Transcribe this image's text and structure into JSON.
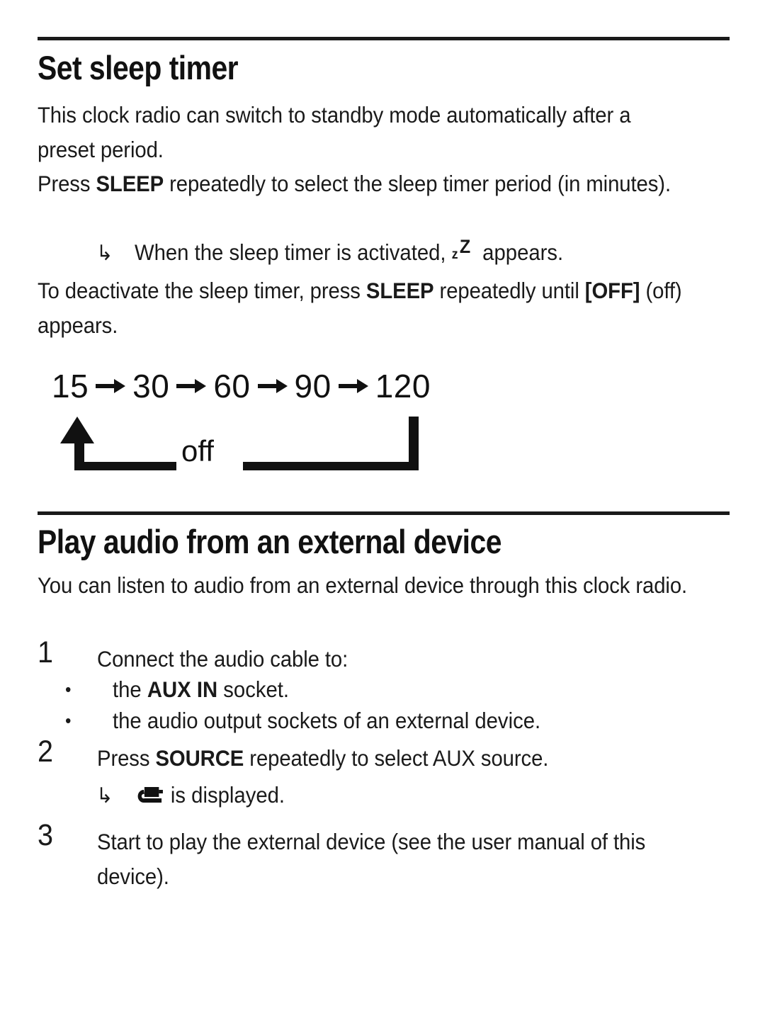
{
  "document": {
    "type": "user-manual-page",
    "background_color": "#ffffff",
    "text_color": "#1a1a1a"
  },
  "sections": [
    {
      "id": "sleep-timer",
      "heading": "Set sleep timer",
      "paragraphs": {
        "intro": "This clock radio can switch to standby mode automatically after a preset period.",
        "press_prefix": "Press ",
        "press_key": "SLEEP",
        "press_suffix": " repeatedly to select the sleep timer period (in minutes).",
        "note_prefix": "When the sleep timer is activated, ",
        "note_suffix": " appears.",
        "deactivate_prefix": "To deactivate the sleep timer, press ",
        "deactivate_key": "SLEEP",
        "deactivate_mid": " repeatedly until ",
        "deactivate_off": "[OFF]",
        "deactivate_suffix": " (off) appears."
      },
      "diagram": {
        "name": "sleep-timer-cycle",
        "values": [
          "15",
          "30",
          "60",
          "90",
          "120"
        ],
        "arrow_glyph": "→",
        "loop_label": "off"
      }
    },
    {
      "id": "external-device",
      "heading": "Play audio from an external device",
      "paragraphs": {
        "intro": "You can listen to audio from an external device through this clock radio."
      },
      "steps": [
        {
          "number": "1",
          "text": "Connect the audio cable to:",
          "bullets": [
            {
              "dot": "•",
              "prefix": "the ",
              "bold": "AUX IN",
              "suffix": " socket."
            },
            {
              "dot": "•",
              "prefix": "the audio output sockets of an external device.",
              "bold": "",
              "suffix": ""
            }
          ]
        },
        {
          "number": "2",
          "prefix": "Press ",
          "bold": "SOURCE",
          "suffix": " repeatedly to select AUX source.",
          "note_suffix": " is displayed."
        },
        {
          "number": "3",
          "text": "Start to play the external device (see the user manual of this device)."
        }
      ]
    }
  ],
  "icons": {
    "sleep_z_small": "z",
    "sleep_z_big": "Z",
    "note_arrow": "↳",
    "aux_plug": "aux-plug-icon"
  }
}
